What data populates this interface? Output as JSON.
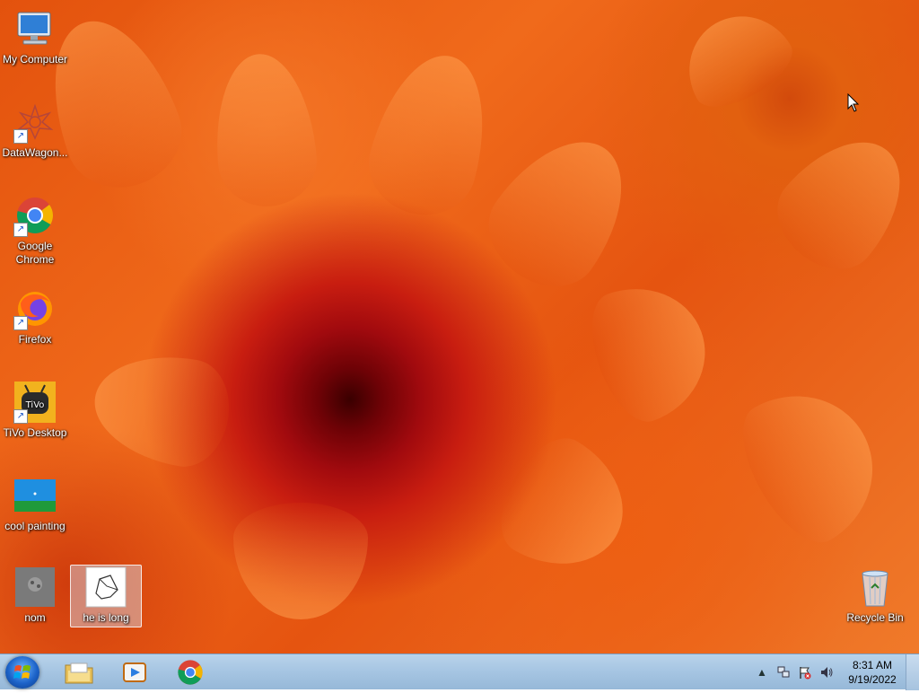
{
  "desktop": {
    "icons": [
      {
        "name": "my-computer-icon",
        "label": "My Computer",
        "icon": "computer-icon"
      },
      {
        "name": "datawagon-icon",
        "label": "DataWagon...",
        "icon": "datawagon-icon"
      },
      {
        "name": "google-chrome-icon",
        "label": "Google Chrome",
        "icon": "chrome-icon"
      },
      {
        "name": "firefox-icon",
        "label": "Firefox",
        "icon": "firefox-icon"
      },
      {
        "name": "tivo-desktop-icon",
        "label": "TiVo Desktop",
        "icon": "tivo-icon"
      },
      {
        "name": "cool-painting-icon",
        "label": "cool painting",
        "icon": "image-file-icon"
      },
      {
        "name": "nom-icon",
        "label": "nom",
        "icon": "image-file-icon"
      },
      {
        "name": "he-is-long-icon",
        "label": "he is long",
        "icon": "image-file-icon"
      },
      {
        "name": "recycle-bin-icon",
        "label": "Recycle Bin",
        "icon": "recycle-bin-icon"
      }
    ]
  },
  "taskbar": {
    "clock_time": "8:31 AM",
    "clock_date": "9/19/2022"
  },
  "colors": {
    "taskbar": "#a7c6e3",
    "wallpaper_primary": "#e3520d",
    "wallpaper_center": "#6e0206"
  }
}
